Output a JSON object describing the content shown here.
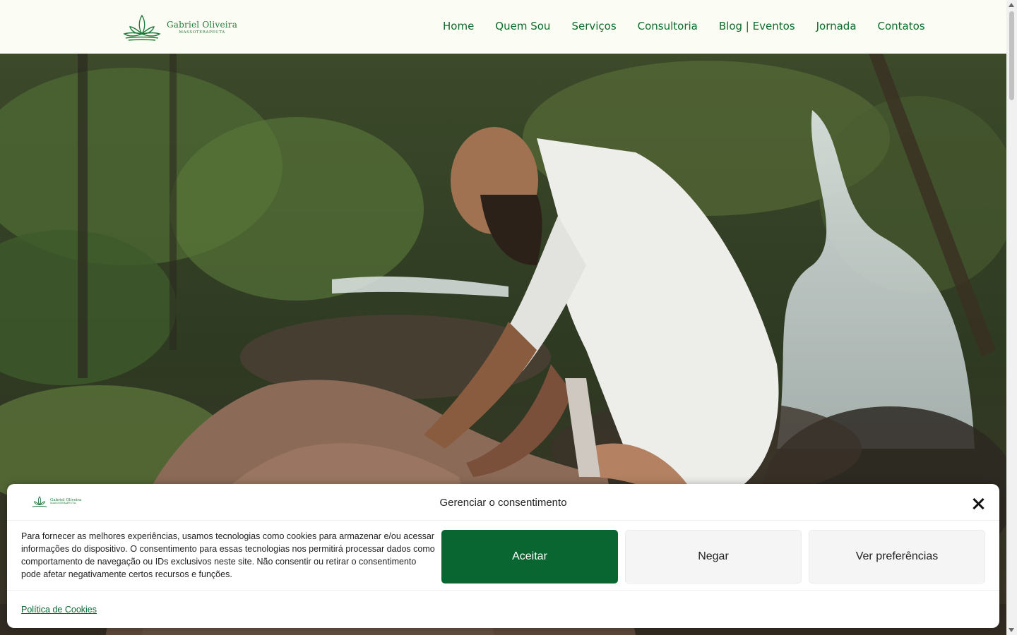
{
  "header": {
    "logo_name": "Gabriel Oliveira",
    "logo_sub": "MASSOTERAPEUTA",
    "nav": [
      "Home",
      "Quem Sou",
      "Serviços",
      "Consultoria",
      "Blog | Eventos",
      "Jornada",
      "Contatos"
    ]
  },
  "hero": {
    "image": "massage-by-waterfall-photo"
  },
  "consent": {
    "logo_name": "Gabriel Oliveira",
    "logo_sub": "MASSOTERAPEUTA",
    "title": "Gerenciar o consentimento",
    "body": "Para fornecer as melhores experiências, usamos tecnologias como cookies para armazenar e/ou acessar informações do dispositivo. O consentimento para essas tecnologias nos permitirá processar dados como comportamento de navegação ou IDs exclusivos neste site. Não consentir ou retirar o consentimento pode afetar negativamente certos recursos e funções.",
    "accept_label": "Aceitar",
    "deny_label": "Negar",
    "prefs_label": "Ver preferências",
    "policy_link": "Política de Cookies"
  },
  "colors": {
    "brand_green": "#0a6630",
    "nav_green": "#0d6b2b",
    "header_bg": "#fbfdf4"
  }
}
